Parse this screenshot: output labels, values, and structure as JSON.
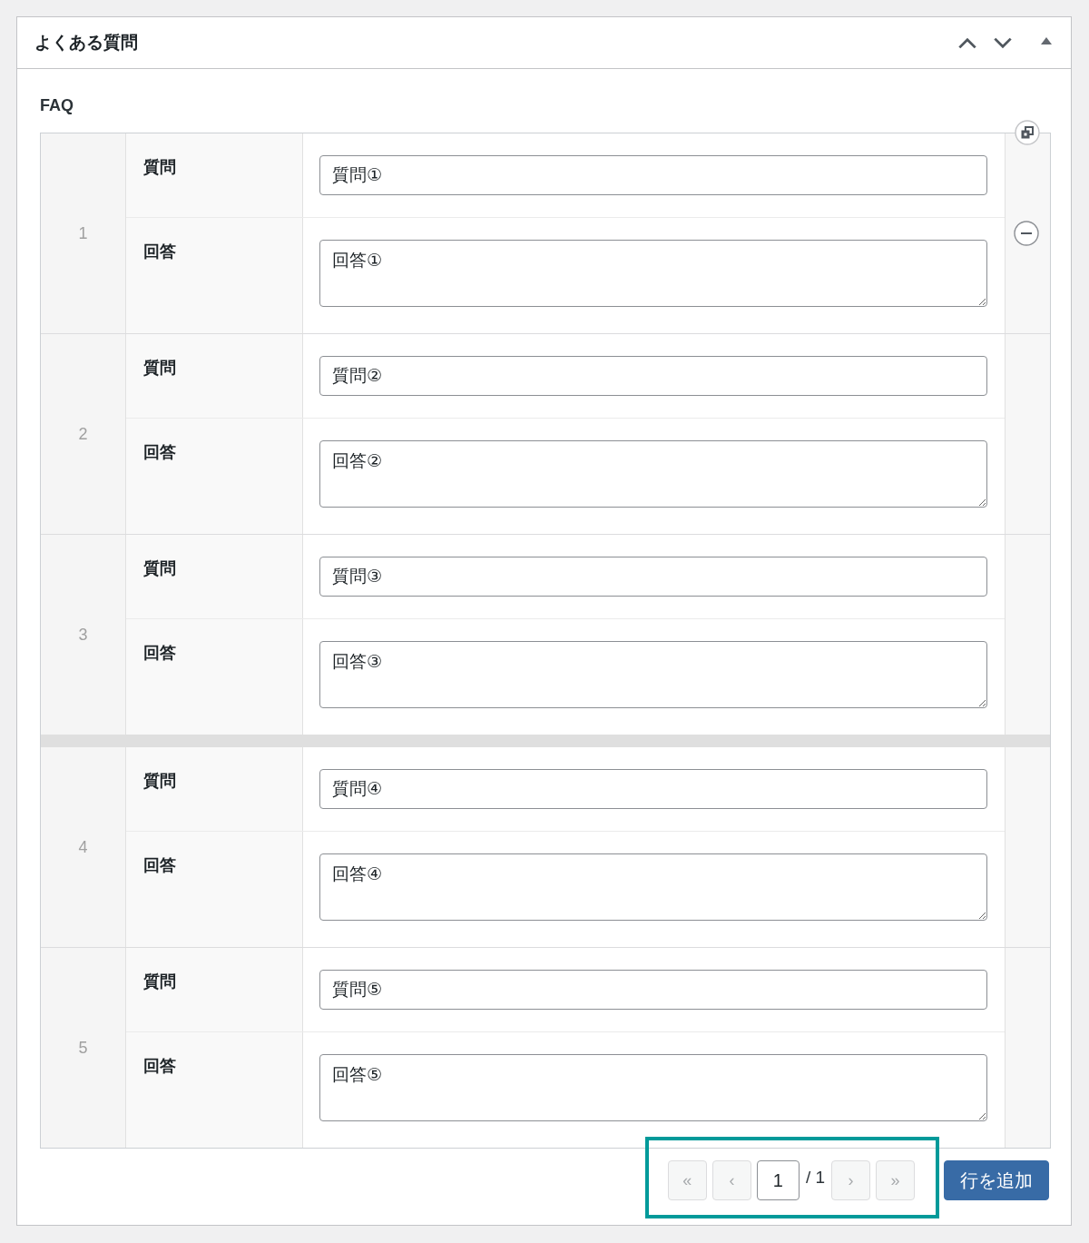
{
  "panel": {
    "title": "よくある質問"
  },
  "field_label": "FAQ",
  "rows": [
    {
      "kind": "row",
      "number": "1",
      "actions_visible": true,
      "fields": [
        {
          "kind": "text",
          "label": "質問",
          "value": "質問①"
        },
        {
          "kind": "textarea",
          "label": "回答",
          "value": "回答①"
        }
      ]
    },
    {
      "kind": "row",
      "number": "2",
      "actions_visible": false,
      "fields": [
        {
          "kind": "text",
          "label": "質問",
          "value": "質問②"
        },
        {
          "kind": "textarea",
          "label": "回答",
          "value": "回答②"
        }
      ]
    },
    {
      "kind": "row",
      "number": "3",
      "actions_visible": false,
      "fields": [
        {
          "kind": "text",
          "label": "質問",
          "value": "質問③"
        },
        {
          "kind": "textarea",
          "label": "回答",
          "value": "回答③"
        }
      ]
    },
    {
      "kind": "separator"
    },
    {
      "kind": "row",
      "number": "4",
      "actions_visible": false,
      "fields": [
        {
          "kind": "text",
          "label": "質問",
          "value": "質問④"
        },
        {
          "kind": "textarea",
          "label": "回答",
          "value": "回答④"
        }
      ]
    },
    {
      "kind": "row",
      "number": "5",
      "actions_visible": false,
      "fields": [
        {
          "kind": "text",
          "label": "質問",
          "value": "質問⑤"
        },
        {
          "kind": "textarea",
          "label": "回答",
          "value": "回答⑤"
        }
      ]
    }
  ],
  "pagination": {
    "highlighted": true,
    "back_buttons": [
      {
        "label": "«",
        "disabled": true
      },
      {
        "label": "‹",
        "disabled": true
      }
    ],
    "page": "1",
    "total": "/ 1",
    "forward_buttons": [
      {
        "label": "›",
        "disabled": true
      },
      {
        "label": "»",
        "disabled": true
      }
    ]
  },
  "add_button": "行を追加"
}
